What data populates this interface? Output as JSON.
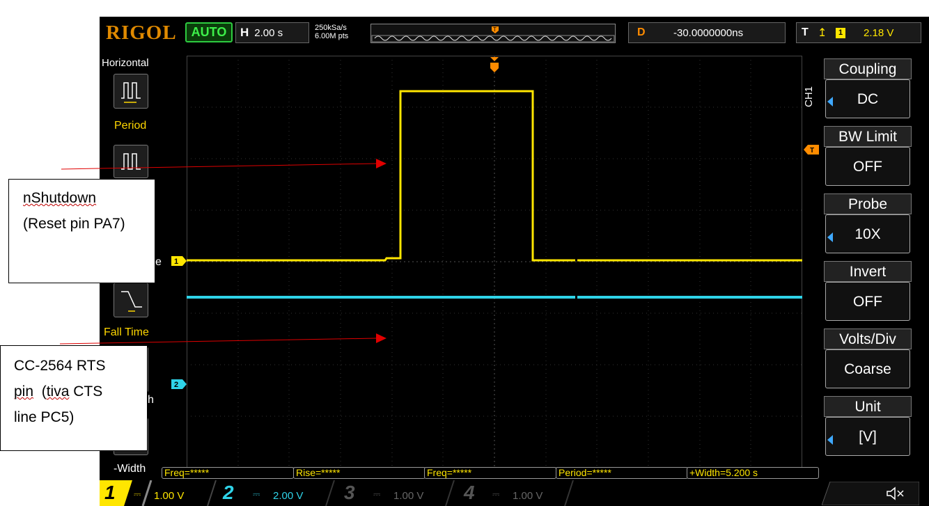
{
  "topbar": {
    "brand": "RIGOL",
    "run_mode": "AUTO",
    "horizontal_label": "H",
    "timebase": "2.00 s",
    "sample_rate": "250kSa/s",
    "memory_depth": "6.00M pts",
    "delay_label": "D",
    "delay_value": "-30.0000000ns",
    "trigger_label": "T",
    "trigger_edge_icon": "rising-edge-icon",
    "trigger_source": "1",
    "trigger_level": "2.18 V"
  },
  "left_menu": {
    "title": "Horizontal",
    "items": [
      {
        "label": "Period",
        "icon": "period-icon"
      },
      {
        "label": "",
        "icon": "frequency-icon"
      },
      {
        "label": "Fall Time",
        "icon": "fall-time-icon"
      },
      {
        "label": "-Width",
        "icon": "neg-width-icon"
      }
    ],
    "partial_letters": [
      "e",
      "h"
    ]
  },
  "right_menu": {
    "channel": "CH1",
    "items": [
      {
        "label": "Coupling",
        "value": "DC"
      },
      {
        "label": "BW Limit",
        "value": "OFF"
      },
      {
        "label": "Probe",
        "value": "10X"
      },
      {
        "label": "Invert",
        "value": "OFF"
      },
      {
        "label": "Volts/Div",
        "value": "Coarse"
      },
      {
        "label": "Unit",
        "value": "[V]"
      }
    ]
  },
  "channel_markers": {
    "ch1": "1",
    "ch2": "2",
    "trigger": "T"
  },
  "measurements": [
    "Freq=*****",
    "Rise=*****",
    "Freq=*****",
    "Period=*****",
    "+Width=5.200 s"
  ],
  "channels": [
    {
      "num": "1",
      "scale": "1.00 V",
      "color": "#ffe600",
      "active": true
    },
    {
      "num": "2",
      "scale": "2.00 V",
      "color": "#2fd3e8",
      "active": true
    },
    {
      "num": "3",
      "scale": "1.00 V",
      "color": "#555555",
      "active": false
    },
    {
      "num": "4",
      "scale": "1.00 V",
      "color": "#555555",
      "active": false
    }
  ],
  "speaker_icon": "speaker-mute-icon",
  "annotations": {
    "box1_line1": "nShutdown",
    "box1_line2": "(Reset pin PA7)",
    "box2_line1": "CC-2564 RTS",
    "box2_line2_a": "pin",
    "box2_line2_b": "(",
    "box2_line2_c": "tiva",
    "box2_line2_d": " CTS",
    "box2_line3": "line PC5)"
  },
  "colors": {
    "ch1": "#ffe600",
    "ch2": "#2fd3e8",
    "trigger": "#ff8c00",
    "arrow": "#e00000"
  }
}
